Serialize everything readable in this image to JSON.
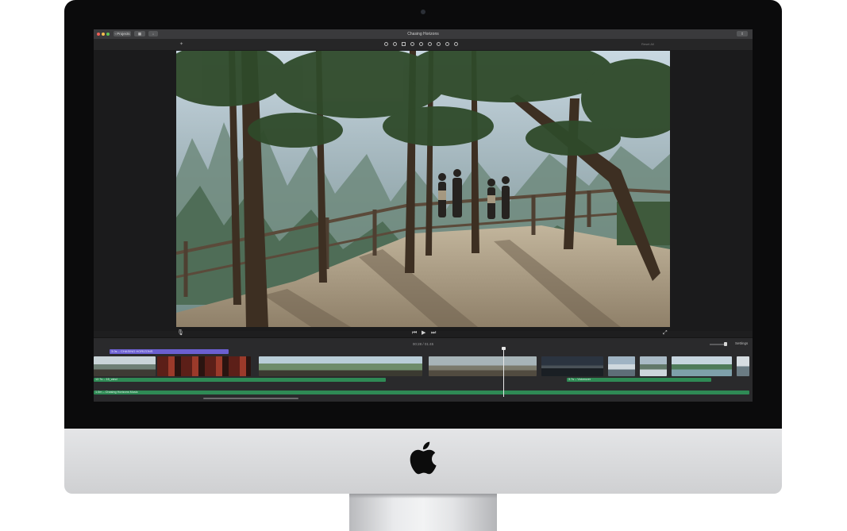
{
  "app": {
    "project_title": "Chasing Horizons",
    "back_button_label": "Projects",
    "reset_label": "Reset All"
  },
  "playback": {
    "timecode": "00:28 / 01:45"
  },
  "timeline": {
    "settings_label": "Settings",
    "title_clip_label": "3.0s – CHASING HORIZONS",
    "audio_clips": [
      {
        "label": "12.7s – 15_wind"
      },
      {
        "label": "3.7s – Voiceover"
      },
      {
        "label": "1.0m – Chasing Horizons Music"
      }
    ]
  },
  "colors": {
    "title_clip": "#6b5fd0",
    "audio_clip": "#2f8a55",
    "ui_background": "#1e1e1f"
  },
  "icons": [
    "apple-logo",
    "play-icon",
    "skip-back-icon",
    "skip-forward-icon",
    "microphone-icon",
    "fullscreen-icon",
    "magic-wand-icon",
    "share-icon"
  ]
}
